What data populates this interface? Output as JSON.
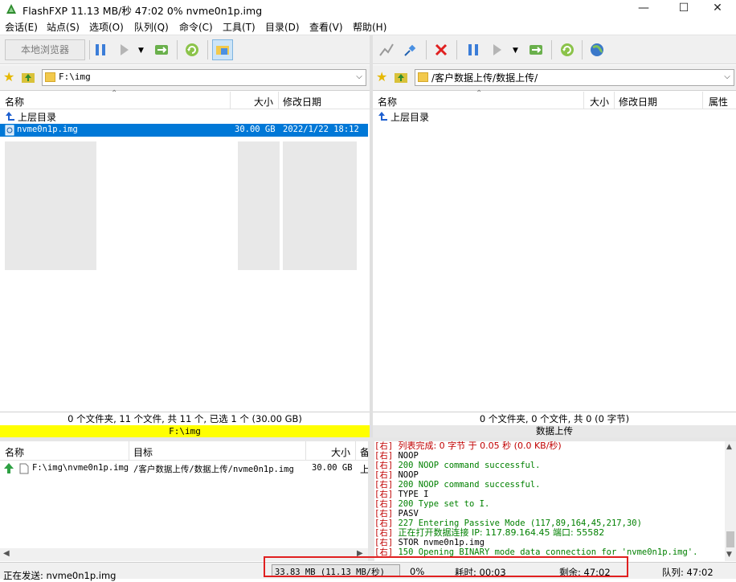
{
  "window": {
    "title": "FlashFXP 11.13 MB/秒 47:02 0% nvme0n1p.img",
    "min_glyph": "—",
    "max_glyph": "☐",
    "close_glyph": "✕"
  },
  "menu": [
    "会话(E)",
    "站点(S)",
    "选项(O)",
    "队列(Q)",
    "命令(C)",
    "工具(T)",
    "目录(D)",
    "查看(V)",
    "帮助(H)"
  ],
  "toolbar_left": {
    "local_browse_label": "本地浏览器"
  },
  "left_panel": {
    "path": "F:\\img",
    "columns": {
      "name": "名称",
      "size": "大小",
      "modified": "修改日期"
    },
    "parent_dir": "上层目录",
    "selected_file": {
      "name": "nvme0n1p.img",
      "size": "30.00 GB",
      "modified": "2022/1/22 18:12"
    },
    "status": "0 个文件夹, 11 个文件, 共 11 个, 已选 1 个 (30.00 GB)",
    "path_status": "F:\\img"
  },
  "right_panel": {
    "path": "/客户数据上传/数据上传/",
    "columns": {
      "name": "名称",
      "size": "大小",
      "modified": "修改日期",
      "attr": "属性"
    },
    "parent_dir": "上层目录",
    "status": "0 个文件夹, 0 个文件, 共 0 (0 字节)",
    "site_name": "数据上传"
  },
  "queue": {
    "columns": {
      "name": "名称",
      "target": "目标",
      "size": "大小",
      "extra": "备"
    },
    "items": [
      {
        "name": "F:\\img\\nvme0n1p.img",
        "target": "/客户数据上传/数据上传/nvme0n1p.img",
        "size": "30.00 GB",
        "extra": "上"
      }
    ]
  },
  "log": [
    {
      "tag": "[右]",
      "text": "列表完成: 0 字节 于 0.05 秒 (0.0 KB/秒)",
      "color": "#c00000"
    },
    {
      "tag": "[右]",
      "text": "NOOP",
      "color": "#000000"
    },
    {
      "tag": "[右]",
      "text": "200 NOOP command successful.",
      "color": "#008000"
    },
    {
      "tag": "[右]",
      "text": "NOOP",
      "color": "#000000"
    },
    {
      "tag": "[右]",
      "text": "200 NOOP command successful.",
      "color": "#008000"
    },
    {
      "tag": "[右]",
      "text": "TYPE I",
      "color": "#000000"
    },
    {
      "tag": "[右]",
      "text": "200 Type set to I.",
      "color": "#008000"
    },
    {
      "tag": "[右]",
      "text": "PASV",
      "color": "#000000"
    },
    {
      "tag": "[右]",
      "text": "227 Entering Passive Mode (117,89,164,45,217,30)",
      "color": "#008000"
    },
    {
      "tag": "[右]",
      "text": "正在打开数据连接 IP: 117.89.164.45 端口: 55582",
      "color": "#008000"
    },
    {
      "tag": "[右]",
      "text": "STOR nvme0n1p.img",
      "color": "#000000"
    },
    {
      "tag": "[右]",
      "text": "150 Opening BINARY mode data connection for 'nvme0n1p.img'.",
      "color": "#008000"
    }
  ],
  "statusbar": {
    "sending": "正在发送: nvme0n1p.img",
    "transferred": "33.83 MB (11.13 MB/秒)",
    "percent": "0%",
    "elapsed": "耗时: 00:03",
    "remaining": "剩余: 47:02",
    "queue": "队列: 47:02"
  },
  "colors": {
    "selected_row": "#0078d7",
    "path_status_bg": "#ffff00",
    "highlight_box": "#e02020"
  }
}
